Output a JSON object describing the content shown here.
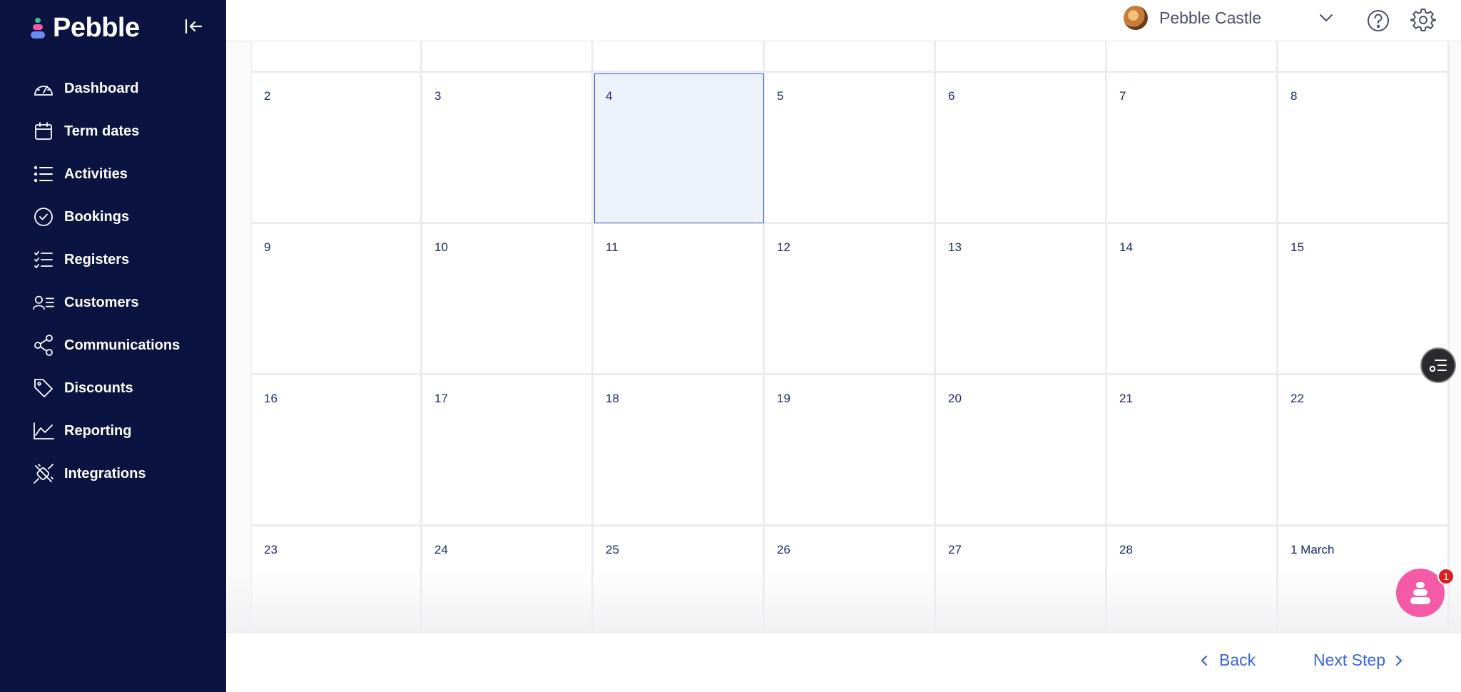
{
  "app": {
    "name": "Pebble"
  },
  "sidebar": {
    "items": [
      {
        "label": "Dashboard",
        "icon": "gauge-icon"
      },
      {
        "label": "Term dates",
        "icon": "calendar-icon"
      },
      {
        "label": "Activities",
        "icon": "list-icon"
      },
      {
        "label": "Bookings",
        "icon": "check-circle-icon"
      },
      {
        "label": "Registers",
        "icon": "checklist-icon"
      },
      {
        "label": "Customers",
        "icon": "user-list-icon"
      },
      {
        "label": "Communications",
        "icon": "share-icon"
      },
      {
        "label": "Discounts",
        "icon": "tag-icon"
      },
      {
        "label": "Reporting",
        "icon": "line-chart-icon"
      },
      {
        "label": "Integrations",
        "icon": "plug-icon"
      }
    ]
  },
  "header": {
    "account_name": "Pebble Castle"
  },
  "calendar": {
    "selected_day": "4",
    "weeks": [
      [
        "",
        "",
        "",
        "",
        "",
        "",
        ""
      ],
      [
        "2",
        "3",
        "4",
        "5",
        "6",
        "7",
        "8"
      ],
      [
        "9",
        "10",
        "11",
        "12",
        "13",
        "14",
        "15"
      ],
      [
        "16",
        "17",
        "18",
        "19",
        "20",
        "21",
        "22"
      ],
      [
        "23",
        "24",
        "25",
        "26",
        "27",
        "28",
        "1 March"
      ]
    ]
  },
  "footer": {
    "back_label": "Back",
    "next_label": "Next Step"
  },
  "chat": {
    "badge_count": "1"
  },
  "colors": {
    "sidebar_bg": "#0b1340",
    "accent": "#3a63d8",
    "selected_bg": "#eef2fd",
    "chat": "#f45aa6",
    "badge": "#d92020"
  }
}
